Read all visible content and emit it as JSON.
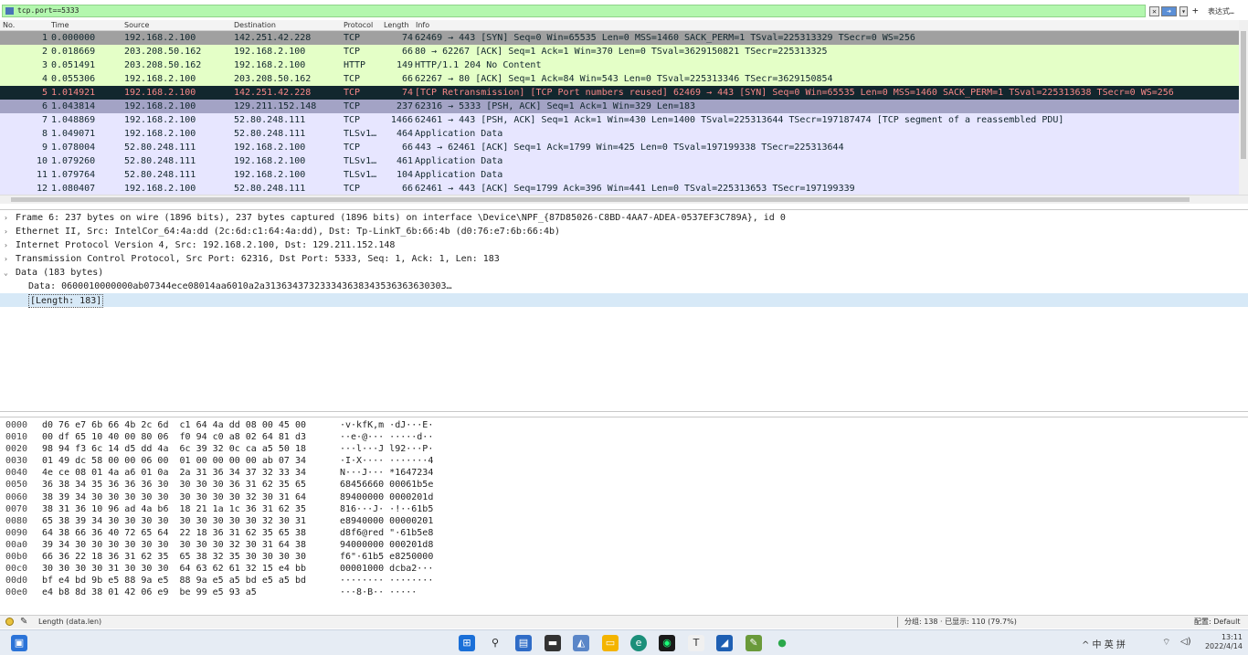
{
  "filter": {
    "value": "tcp.port==5333",
    "clear_label": "✕",
    "apply_label": "➜",
    "dropdown_label": "▾",
    "add_label": "+",
    "expression_label": "表达式…"
  },
  "packet_list": {
    "columns": [
      "No.",
      "Time",
      "Source",
      "Destination",
      "Protocol",
      "Length",
      "Info"
    ],
    "rows": [
      {
        "no": "1",
        "time": "0.000000",
        "src": "192.168.2.100",
        "dst": "142.251.42.228",
        "proto": "TCP",
        "len": "74",
        "info": "62469 → 443 [SYN] Seq=0 Win=65535 Len=0 MSS=1460 SACK_PERM=1 TSval=225313329 TSecr=0 WS=256",
        "bg": "#a0a0a0",
        "fg": "#12272e"
      },
      {
        "no": "2",
        "time": "0.018669",
        "src": "203.208.50.162",
        "dst": "192.168.2.100",
        "proto": "TCP",
        "len": "66",
        "info": "80 → 62267 [ACK] Seq=1 Ack=1 Win=370 Len=0 TSval=3629150821 TSecr=225313325",
        "bg": "#e4ffc7",
        "fg": "#12272e"
      },
      {
        "no": "3",
        "time": "0.051491",
        "src": "203.208.50.162",
        "dst": "192.168.2.100",
        "proto": "HTTP",
        "len": "149",
        "info": "HTTP/1.1 204 No Content",
        "bg": "#e4ffc7",
        "fg": "#12272e"
      },
      {
        "no": "4",
        "time": "0.055306",
        "src": "192.168.2.100",
        "dst": "203.208.50.162",
        "proto": "TCP",
        "len": "66",
        "info": "62267 → 80 [ACK] Seq=1 Ack=84 Win=543 Len=0 TSval=225313346 TSecr=3629150854",
        "bg": "#e4ffc7",
        "fg": "#12272e"
      },
      {
        "no": "5",
        "time": "1.014921",
        "src": "192.168.2.100",
        "dst": "142.251.42.228",
        "proto": "TCP",
        "len": "74",
        "info": "[TCP Retransmission] [TCP Port numbers reused] 62469 → 443 [SYN] Seq=0 Win=65535 Len=0 MSS=1460 SACK_PERM=1 TSval=225313638 TSecr=0 WS=256",
        "bg": "#12272e",
        "fg": "#f78787"
      },
      {
        "no": "6",
        "time": "1.043814",
        "src": "192.168.2.100",
        "dst": "129.211.152.148",
        "proto": "TCP",
        "len": "237",
        "info": "62316 → 5333 [PSH, ACK] Seq=1 Ack=1 Win=329 Len=183",
        "bg": "#a3a3c5",
        "fg": "#12272e"
      },
      {
        "no": "7",
        "time": "1.048869",
        "src": "192.168.2.100",
        "dst": "52.80.248.111",
        "proto": "TCP",
        "len": "1466",
        "info": "62461 → 443 [PSH, ACK] Seq=1 Ack=1 Win=430 Len=1400 TSval=225313644 TSecr=197187474 [TCP segment of a reassembled PDU]",
        "bg": "#e7e6ff",
        "fg": "#12272e"
      },
      {
        "no": "8",
        "time": "1.049071",
        "src": "192.168.2.100",
        "dst": "52.80.248.111",
        "proto": "TLSv1…",
        "len": "464",
        "info": "Application Data",
        "bg": "#e7e6ff",
        "fg": "#12272e"
      },
      {
        "no": "9",
        "time": "1.078004",
        "src": "52.80.248.111",
        "dst": "192.168.2.100",
        "proto": "TCP",
        "len": "66",
        "info": "443 → 62461 [ACK] Seq=1 Ack=1799 Win=425 Len=0 TSval=197199338 TSecr=225313644",
        "bg": "#e7e6ff",
        "fg": "#12272e"
      },
      {
        "no": "10",
        "time": "1.079260",
        "src": "52.80.248.111",
        "dst": "192.168.2.100",
        "proto": "TLSv1…",
        "len": "461",
        "info": "Application Data",
        "bg": "#e7e6ff",
        "fg": "#12272e"
      },
      {
        "no": "11",
        "time": "1.079764",
        "src": "52.80.248.111",
        "dst": "192.168.2.100",
        "proto": "TLSv1…",
        "len": "104",
        "info": "Application Data",
        "bg": "#e7e6ff",
        "fg": "#12272e"
      },
      {
        "no": "12",
        "time": "1.080407",
        "src": "192.168.2.100",
        "dst": "52.80.248.111",
        "proto": "TCP",
        "len": "66",
        "info": "62461 → 443 [ACK] Seq=1799 Ack=396 Win=441 Len=0 TSval=225313653 TSecr=197199339",
        "bg": "#e7e6ff",
        "fg": "#12272e"
      }
    ]
  },
  "details": [
    {
      "arrow": "›",
      "text": "Frame 6: 237 bytes on wire (1896 bits), 237 bytes captured (1896 bits) on interface \\Device\\NPF_{87D85026-C8BD-4AA7-ADEA-0537EF3C789A}, id 0",
      "child": false,
      "sel": false
    },
    {
      "arrow": "›",
      "text": "Ethernet II, Src: IntelCor_64:4a:dd (2c:6d:c1:64:4a:dd), Dst: Tp-LinkT_6b:66:4b (d0:76:e7:6b:66:4b)",
      "child": false,
      "sel": false
    },
    {
      "arrow": "›",
      "text": "Internet Protocol Version 4, Src: 192.168.2.100, Dst: 129.211.152.148",
      "child": false,
      "sel": false
    },
    {
      "arrow": "›",
      "text": "Transmission Control Protocol, Src Port: 62316, Dst Port: 5333, Seq: 1, Ack: 1, Len: 183",
      "child": false,
      "sel": false
    },
    {
      "arrow": "⌄",
      "text": "Data (183 bytes)",
      "child": false,
      "sel": false
    },
    {
      "arrow": "",
      "text": "Data: 0600010000000ab07344ece08014aa6010a2a313634373233343638343536363630303…",
      "child": true,
      "sel": false
    },
    {
      "arrow": "",
      "text": "[Length: 183]",
      "child": true,
      "sel": true
    }
  ],
  "bytes": [
    {
      "off": "0000",
      "hex": "d0 76 e7 6b 66 4b 2c 6d  c1 64 4a dd 08 00 45 00",
      "asc": "·v·kfK,m ·dJ···E·"
    },
    {
      "off": "0010",
      "hex": "00 df 65 10 40 00 80 06  f0 94 c0 a8 02 64 81 d3",
      "asc": "··e·@··· ·····d··"
    },
    {
      "off": "0020",
      "hex": "98 94 f3 6c 14 d5 dd 4a  6c 39 32 0c ca a5 50 18",
      "asc": "···l···J l92···P·"
    },
    {
      "off": "0030",
      "hex": "01 49 dc 58 00 00 06 00  01 00 00 00 00 ab 07 34",
      "asc": "·I·X···· ·······4"
    },
    {
      "off": "0040",
      "hex": "4e ce 08 01 4a a6 01 0a  2a 31 36 34 37 32 33 34",
      "asc": "N···J··· *1647234"
    },
    {
      "off": "0050",
      "hex": "36 38 34 35 36 36 36 30  30 30 30 36 31 62 35 65",
      "asc": "68456660 00061b5e"
    },
    {
      "off": "0060",
      "hex": "38 39 34 30 30 30 30 30  30 30 30 30 32 30 31 64",
      "asc": "89400000 0000201d"
    },
    {
      "off": "0070",
      "hex": "38 31 36 10 96 ad 4a b6  18 21 1a 1c 36 31 62 35",
      "asc": "816···J· ·!··61b5"
    },
    {
      "off": "0080",
      "hex": "65 38 39 34 30 30 30 30  30 30 30 30 30 32 30 31",
      "asc": "e8940000 00000201"
    },
    {
      "off": "0090",
      "hex": "64 38 66 36 40 72 65 64  22 18 36 31 62 35 65 38",
      "asc": "d8f6@red \"·61b5e8"
    },
    {
      "off": "00a0",
      "hex": "39 34 30 30 30 30 30 30  30 30 30 32 30 31 64 38",
      "asc": "94000000 000201d8"
    },
    {
      "off": "00b0",
      "hex": "66 36 22 18 36 31 62 35  65 38 32 35 30 30 30 30",
      "asc": "f6\"·61b5 e8250000"
    },
    {
      "off": "00c0",
      "hex": "30 30 30 30 31 30 30 30  64 63 62 61 32 15 e4 bb",
      "asc": "00001000 dcba2···"
    },
    {
      "off": "00d0",
      "hex": "bf e4 bd 9b e5 88 9a e5  88 9a e5 a5 bd e5 a5 bd",
      "asc": "········ ········"
    },
    {
      "off": "00e0",
      "hex": "e4 b8 8d 38 01 42 06 e9  be 99 e5 93 a5",
      "asc": "···8·B·· ·····"
    }
  ],
  "status": {
    "field_text": "Length (data.len)",
    "packets_text": "分组: 138 · 已显示: 110 (79.7%)",
    "profile_text": "配置: Default"
  },
  "taskbar": {
    "tray_text": "^  中  英  拼",
    "time": "13:11",
    "date": "2022/4/14"
  },
  "colors": {
    "filter_valid": "#b3f7ae",
    "selected_detail": "#d7e9f7"
  }
}
